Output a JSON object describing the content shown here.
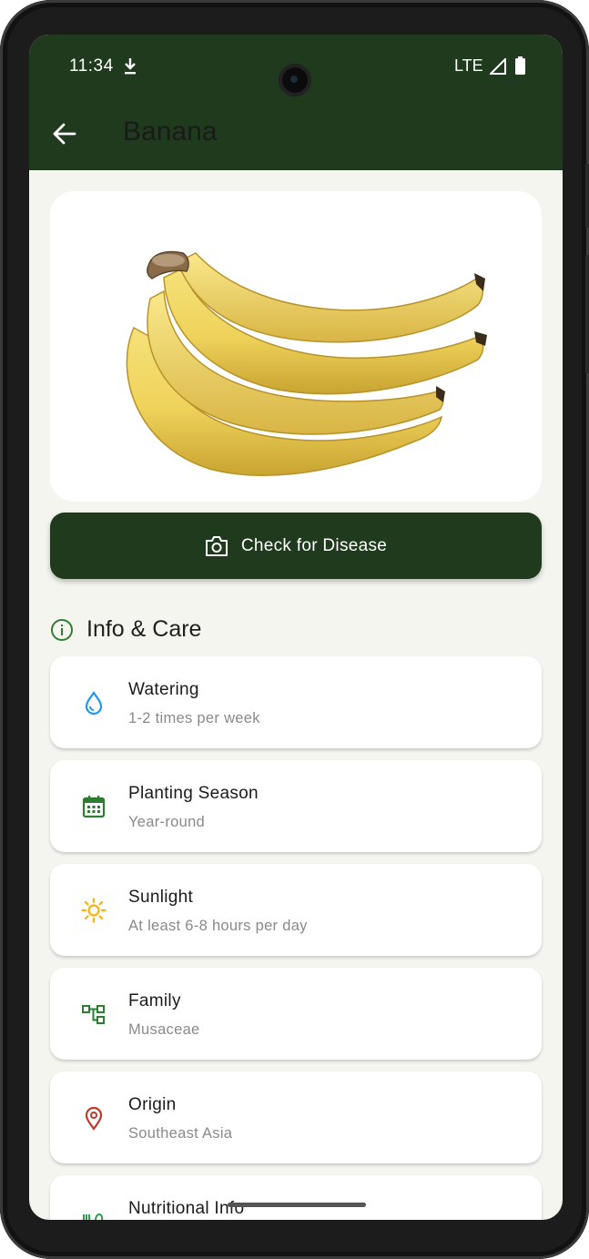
{
  "status_bar": {
    "time": "11:34",
    "network": "LTE"
  },
  "app_bar": {
    "title": "Banana",
    "back_icon": "arrow-left-icon"
  },
  "hero_image": {
    "subject": "banana bunch"
  },
  "actions": {
    "check_disease_label": "Check for Disease",
    "check_disease_icon": "camera-icon"
  },
  "section": {
    "title": "Info & Care",
    "icon": "info-circle-icon"
  },
  "info_items": [
    {
      "title": "Watering",
      "value": "1-2 times per week",
      "icon": "water-drop-icon",
      "color": "#2196f3"
    },
    {
      "title": "Planting Season",
      "value": "Year-round",
      "icon": "calendar-icon",
      "color": "#2e7d32"
    },
    {
      "title": "Sunlight",
      "value": "At least 6-8 hours per day",
      "icon": "sun-icon",
      "color": "#f9b208"
    },
    {
      "title": "Family",
      "value": "Musaceae",
      "icon": "family-tree-icon",
      "color": "#2e7d32"
    },
    {
      "title": "Origin",
      "value": "Southeast Asia",
      "icon": "location-pin-icon",
      "color": "#c0392b"
    },
    {
      "title": "Nutritional Info",
      "value": "",
      "icon": "nutrition-icon",
      "color": "#2e9e4f"
    }
  ],
  "colors": {
    "primary_dark": "#1f3a1d",
    "background": "#f5f5f0",
    "card": "#ffffff"
  }
}
